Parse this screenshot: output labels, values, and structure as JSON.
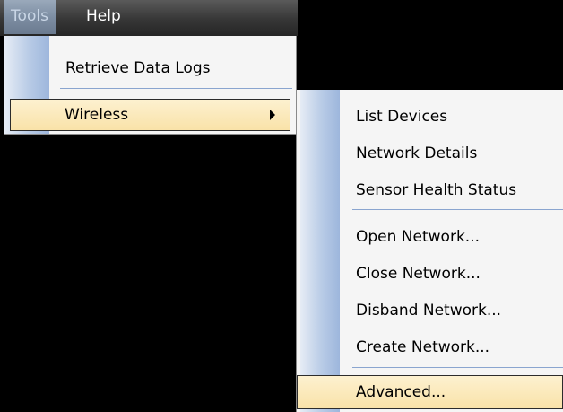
{
  "menubar": {
    "tools_label": "Tools",
    "help_label": "Help"
  },
  "tools_menu": {
    "items": [
      {
        "label": "Retrieve Data Logs"
      },
      {
        "label": "Wireless"
      }
    ]
  },
  "wireless_menu": {
    "items": [
      {
        "label": "List Devices"
      },
      {
        "label": "Network Details"
      },
      {
        "label": "Sensor Health Status"
      },
      {
        "label": "Open Network..."
      },
      {
        "label": "Close Network..."
      },
      {
        "label": "Disband Network..."
      },
      {
        "label": "Create Network..."
      },
      {
        "label": "Advanced..."
      }
    ]
  },
  "colors": {
    "background": "#000000",
    "menu_background": "#f5f5f5",
    "highlight": "#f9e2a8",
    "gutter": "#b8cbe6",
    "separator": "#8aa5cf"
  }
}
